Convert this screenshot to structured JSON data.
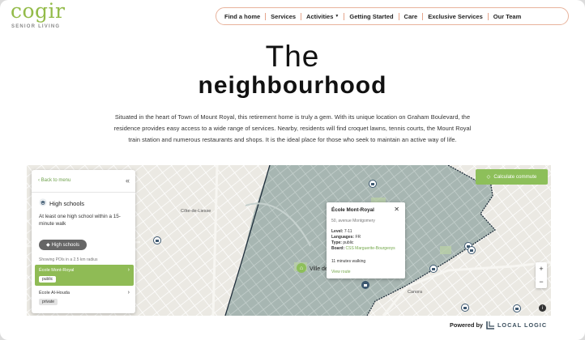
{
  "brand": {
    "name": "cogir",
    "subtitle": "SENIOR LIVING",
    "accent": "#93bb49"
  },
  "nav": {
    "items": [
      {
        "label": "Find a home"
      },
      {
        "label": "Services"
      },
      {
        "label": "Activities",
        "dropdown": true
      },
      {
        "label": "Getting Started"
      },
      {
        "label": "Care"
      },
      {
        "label": "Exclusive Services"
      },
      {
        "label": "Our Team"
      }
    ],
    "dropdown_icon": "chevron-down-icon"
  },
  "hero": {
    "title_light": "The",
    "title_bold": "neighbourhood",
    "intro": "Situated in the heart of Town of Mount Royal, this retirement home is truly a gem. With its unique location on Graham Boulevard, the residence provides easy access to a wide range of services. Nearby, residents will find croquet lawns, tennis courts, the Mount Royal train station and numerous restaurants and shops. It is the ideal place for those who seek to maintain an active way of life."
  },
  "map": {
    "panel": {
      "back_label": "Back to menu",
      "category_title": "High schools",
      "category_desc": "At least one high school within a 15-minute walk",
      "chip_label": "High schools",
      "pois_note": "Showing POIs in a 2.5 km radius",
      "schools": [
        {
          "name": "École Mont-Royal",
          "tag": "public",
          "active": true
        },
        {
          "name": "École Al-Houda",
          "tag": "private",
          "active": false
        }
      ]
    },
    "calc_label": "Calculate commute",
    "popup": {
      "title": "École Mont-Royal",
      "address": "50, avenue Montgomery",
      "level_label": "Level:",
      "level": "7-11",
      "languages_label": "Languages:",
      "languages": "FR",
      "type_label": "Type:",
      "type": "public",
      "board_label": "Board:",
      "board": "CSS Marguerite-Bourgeoys",
      "walk": "11 minutes walking",
      "route_label": "View route"
    },
    "labels": {
      "cote": "Côte-de-Liesse",
      "ville": "Ville de",
      "canora": "Canora"
    },
    "zoom": {
      "in": "+",
      "out": "−"
    },
    "info_label": "i",
    "colors": {
      "green": "#8dbf5a",
      "zone": "#a9b8b4",
      "boundary": "#1f2e3b"
    }
  },
  "footer": {
    "powered_by": "Powered by",
    "provider": "LOCAL LOGIC"
  }
}
